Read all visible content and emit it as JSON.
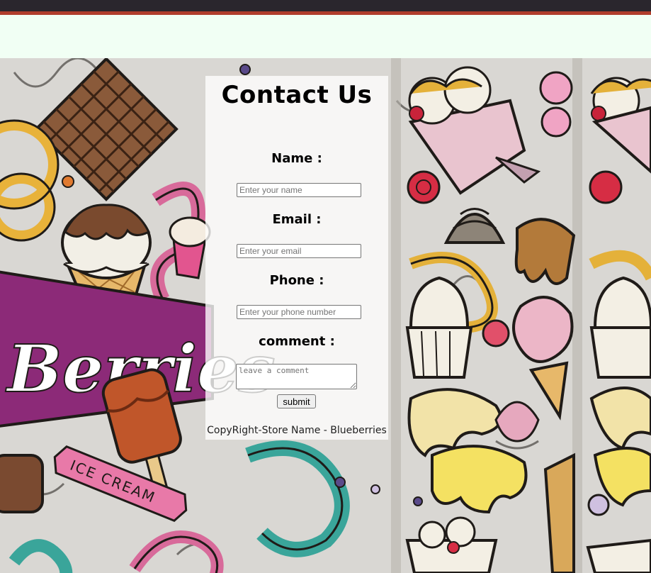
{
  "page": {
    "title": "Contact Us",
    "background_art_text": "Berries",
    "ribbon_text": "ICE CREAM"
  },
  "form": {
    "name_label": "Name :",
    "name_placeholder": "Enter your name",
    "email_label": "Email :",
    "email_placeholder": "Enter your email",
    "phone_label": "Phone :",
    "phone_placeholder": "Enter your phone number",
    "comment_label": "comment :",
    "comment_placeholder": "leave a comment",
    "submit_label": "submit"
  },
  "footer": {
    "text": "CopyRight-Store Name - Blueberries"
  },
  "colors": {
    "top_bar": "#2a262d",
    "top_bar_accent": "#b03d2c",
    "header_strip": "#f1fff4",
    "brand_purple": "#8c2a78"
  }
}
